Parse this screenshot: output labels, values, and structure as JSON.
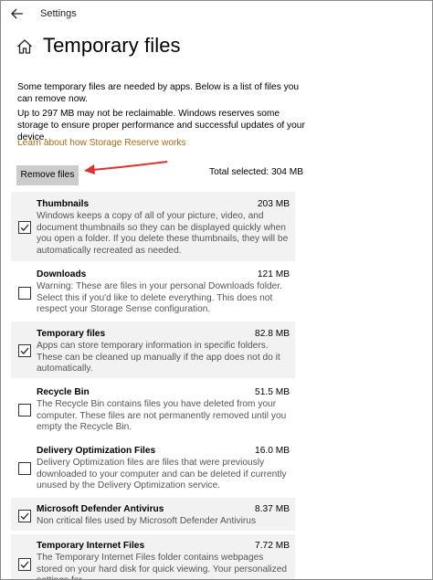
{
  "app": {
    "title": "Settings"
  },
  "page": {
    "title": "Temporary files"
  },
  "description": {
    "line1": "Some temporary files are needed by apps. Below is a list of files you can remove now.",
    "line2": "Up to 297 MB may not be reclaimable. Windows reserves some storage to ensure proper performance and successful updates of your device."
  },
  "link": {
    "label": "Learn about how Storage Reserve works"
  },
  "actions": {
    "remove_label": "Remove files",
    "total_selected": "Total selected: 304 MB"
  },
  "items": [
    {
      "name": "Thumbnails",
      "size": "203 MB",
      "checked": true,
      "desc": "Windows keeps a copy of all of your picture, video, and document thumbnails so they can be displayed quickly when you open a folder. If you delete these thumbnails, they will be automatically recreated as needed."
    },
    {
      "name": "Downloads",
      "size": "121 MB",
      "checked": false,
      "desc": "Warning: These are files in your personal Downloads folder. Select this if you'd like to delete everything. This does not respect your Storage Sense configuration."
    },
    {
      "name": "Temporary files",
      "size": "82.8 MB",
      "checked": true,
      "desc": "Apps can store temporary information in specific folders. These can be cleaned up manually if the app does not do it automatically."
    },
    {
      "name": "Recycle Bin",
      "size": "51.5 MB",
      "checked": false,
      "desc": "The Recycle Bin contains files you have deleted from your computer. These files are not permanently removed until you empty the Recycle Bin."
    },
    {
      "name": "Delivery Optimization Files",
      "size": "16.0 MB",
      "checked": false,
      "desc": "Delivery Optimization files are files that were previously downloaded to your computer and can be deleted if currently unused by the Delivery Optimization service."
    },
    {
      "name": "Microsoft Defender Antivirus",
      "size": "8.37 MB",
      "checked": true,
      "desc": "Non critical files used by Microsoft Defender Antivirus"
    },
    {
      "name": "Temporary Internet Files",
      "size": "7.72 MB",
      "checked": true,
      "desc": "The Temporary Internet Files folder contains webpages stored on your hard disk for quick viewing. Your personalized settings for"
    }
  ],
  "colors": {
    "link": "#a86a10",
    "button": "#cccccc",
    "arrow": "#e03030",
    "row_highlight": "#f2f2f2"
  }
}
